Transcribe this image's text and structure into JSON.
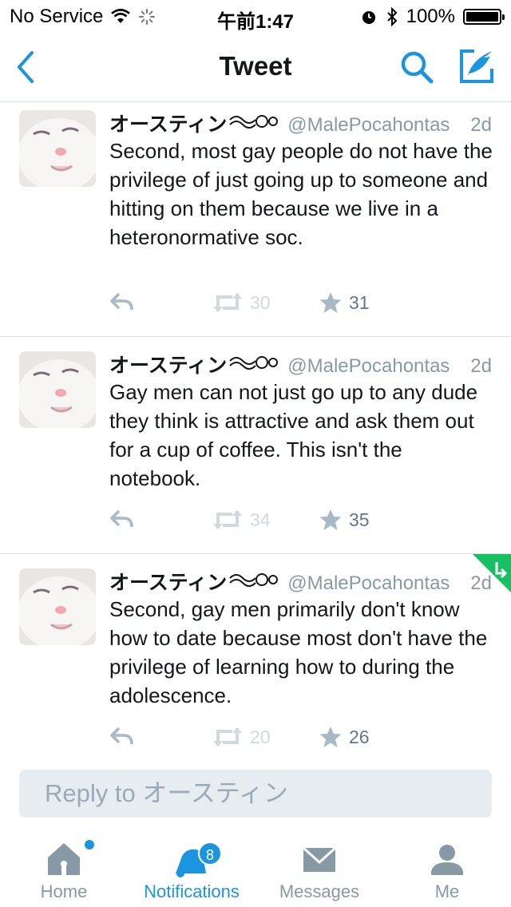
{
  "status_bar": {
    "carrier": "No Service",
    "time": "午前1:47",
    "battery": "100%",
    "battery_level": 1.0
  },
  "nav": {
    "title": "Tweet",
    "back_icon": "chevron-left-icon",
    "search_icon": "search-icon",
    "compose_icon": "compose-icon"
  },
  "tweets": [
    {
      "name": "オースティン",
      "handle": "@MalePocahontas",
      "time": "2d",
      "text": "Second, most gay people do not have the privilege of just going up to someone and hitting on them because we live in a heteronormative soc.",
      "retweets": "30",
      "likes": "31"
    },
    {
      "name": "オースティン",
      "handle": "@MalePocahontas",
      "time": "2d",
      "text": "Gay men can not just go up to any dude they think is attractive and ask them out for a cup of coffee. This isn't the notebook.",
      "retweets": "34",
      "likes": "35"
    },
    {
      "name": "オースティン",
      "handle": "@MalePocahontas",
      "time": "2d",
      "text": "Second, gay men primarily don't know how to date because most don't have the privilege of learning how to during the adolescence.",
      "retweets": "20",
      "likes": "26"
    }
  ],
  "reply": {
    "placeholder": "Reply to オースティン"
  },
  "tabbar": {
    "home": "Home",
    "notifications": "Notifications",
    "notifications_badge": "8",
    "messages": "Messages",
    "me": "Me"
  },
  "colors": {
    "accent": "#1b95e0",
    "muted": "#8899a6",
    "retweet_corner": "#17bf63"
  }
}
